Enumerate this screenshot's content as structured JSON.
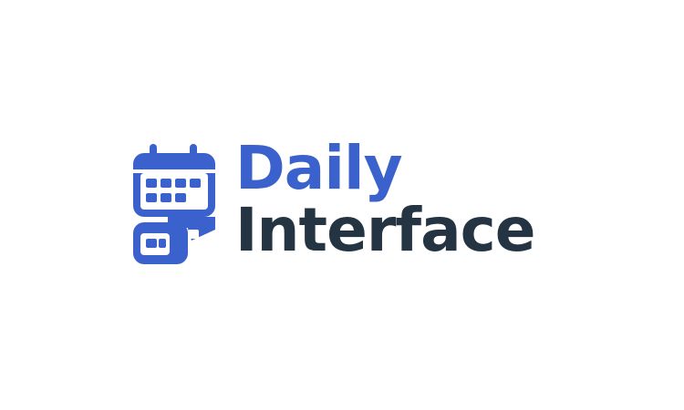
{
  "logo": {
    "icon": "calendar-icon",
    "wordmark_line1": "Daily",
    "wordmark_line2": "Interface"
  },
  "colors": {
    "brand_blue": "#3b62cc",
    "text_dark": "#243442",
    "background": "#ffffff"
  }
}
